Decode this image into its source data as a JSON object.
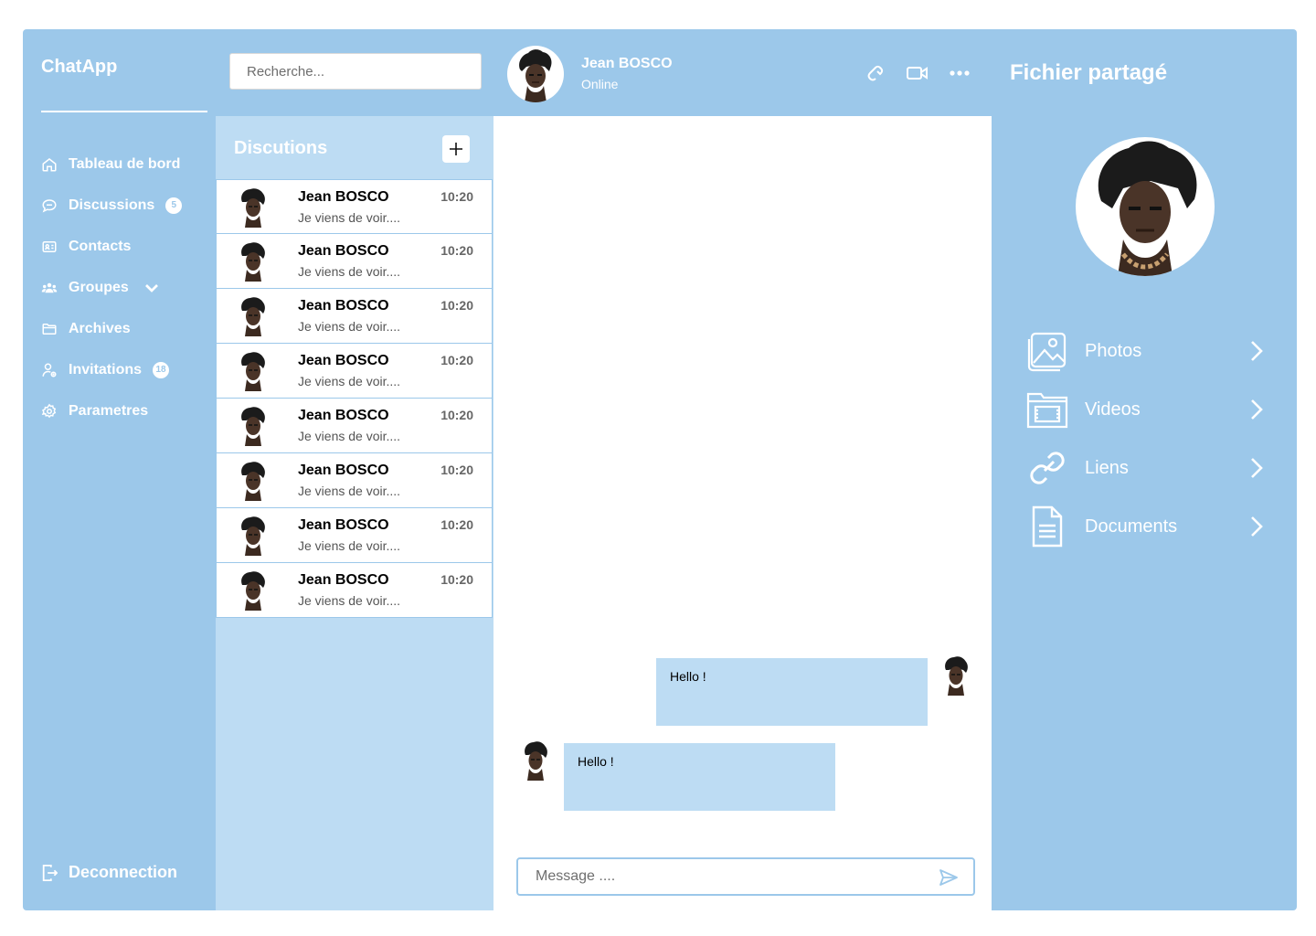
{
  "app": {
    "name": "ChatApp"
  },
  "sidebar": {
    "items": [
      {
        "label": "Tableau de bord",
        "icon": "home-icon"
      },
      {
        "label": "Discussions",
        "icon": "chat-bubble-icon",
        "badge": "5"
      },
      {
        "label": "Contacts",
        "icon": "contact-card-icon"
      },
      {
        "label": "Groupes",
        "icon": "users-icon"
      },
      {
        "label": "Archives",
        "icon": "folder-icon"
      },
      {
        "label": "Invitations",
        "icon": "user-add-icon",
        "badge": "18"
      },
      {
        "label": "Parametres",
        "icon": "gear-icon"
      }
    ],
    "logout": "Deconnection"
  },
  "search": {
    "placeholder": "Recherche..."
  },
  "header": {
    "name": "Jean BOSCO",
    "status": "Online"
  },
  "discussions": {
    "title": "Discutions",
    "items": [
      {
        "name": "Jean BOSCO",
        "preview": "Je viens de voir....",
        "time": "10:20"
      },
      {
        "name": "Jean BOSCO",
        "preview": "Je viens de voir....",
        "time": "10:20"
      },
      {
        "name": "Jean BOSCO",
        "preview": "Je viens de voir....",
        "time": "10:20"
      },
      {
        "name": "Jean BOSCO",
        "preview": "Je viens de voir....",
        "time": "10:20"
      },
      {
        "name": "Jean BOSCO",
        "preview": "Je viens de voir....",
        "time": "10:20"
      },
      {
        "name": "Jean BOSCO",
        "preview": "Je viens de voir....",
        "time": "10:20"
      },
      {
        "name": "Jean BOSCO",
        "preview": "Je viens de voir....",
        "time": "10:20"
      },
      {
        "name": "Jean BOSCO",
        "preview": "Je viens de voir....",
        "time": "10:20"
      }
    ]
  },
  "chat": {
    "messages": [
      {
        "direction": "out",
        "text": "Hello !"
      },
      {
        "direction": "in",
        "text": "Hello !"
      }
    ],
    "input_placeholder": "Message ...."
  },
  "shared": {
    "title": "Fichier partagé",
    "items": [
      {
        "label": "Photos",
        "icon": "image-icon"
      },
      {
        "label": "Videos",
        "icon": "video-folder-icon"
      },
      {
        "label": "Liens",
        "icon": "link-icon"
      },
      {
        "label": "Documents",
        "icon": "document-icon"
      }
    ]
  },
  "colors": {
    "panel": "#9cc8ea",
    "light": "#bddcf3",
    "accent": "#ffffff"
  }
}
